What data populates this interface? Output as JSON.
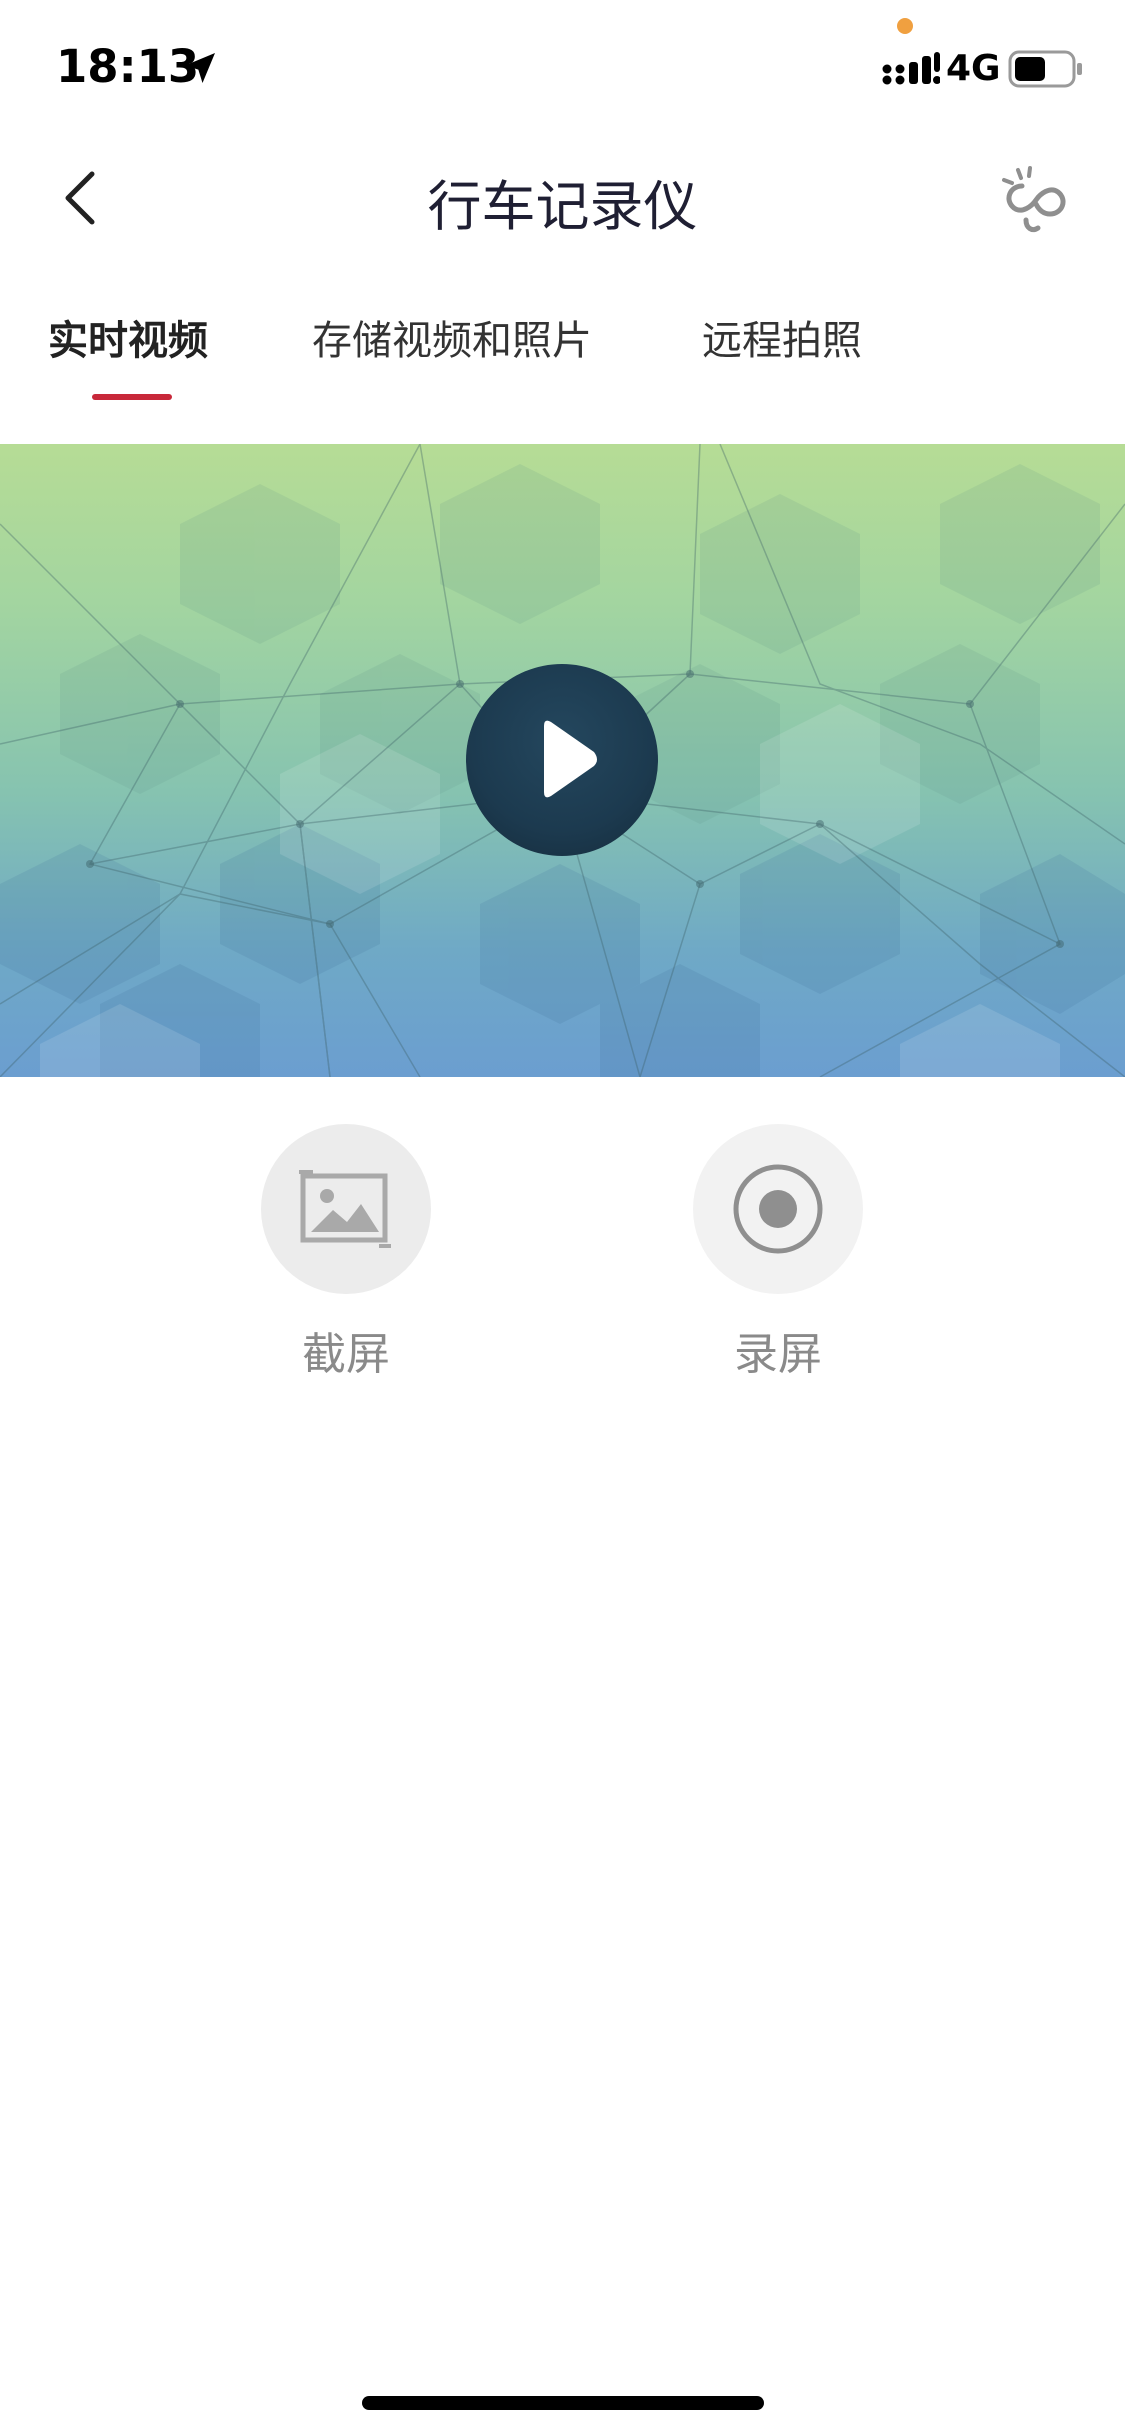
{
  "status_bar": {
    "time": "18:13",
    "network": "4G",
    "icons": [
      "location-arrow-icon",
      "signal-icon",
      "battery-icon"
    ]
  },
  "nav": {
    "title": "行车记录仪",
    "back_icon": "chevron-left-icon",
    "right_icon": "connect-icon"
  },
  "tabs": [
    {
      "label": "实时视频",
      "active": true
    },
    {
      "label": "存储视频和照片",
      "active": false
    },
    {
      "label": "远程拍照",
      "active": false
    }
  ],
  "video": {
    "play_icon": "play-icon"
  },
  "actions": [
    {
      "label": "截屏",
      "icon": "image-icon"
    },
    {
      "label": "录屏",
      "icon": "record-icon"
    }
  ],
  "colors": {
    "accent": "#c8283a",
    "action_bg_disabled": "#ececec",
    "action_bg": "#f2f2f2",
    "label_gray": "#8a8a8a"
  }
}
